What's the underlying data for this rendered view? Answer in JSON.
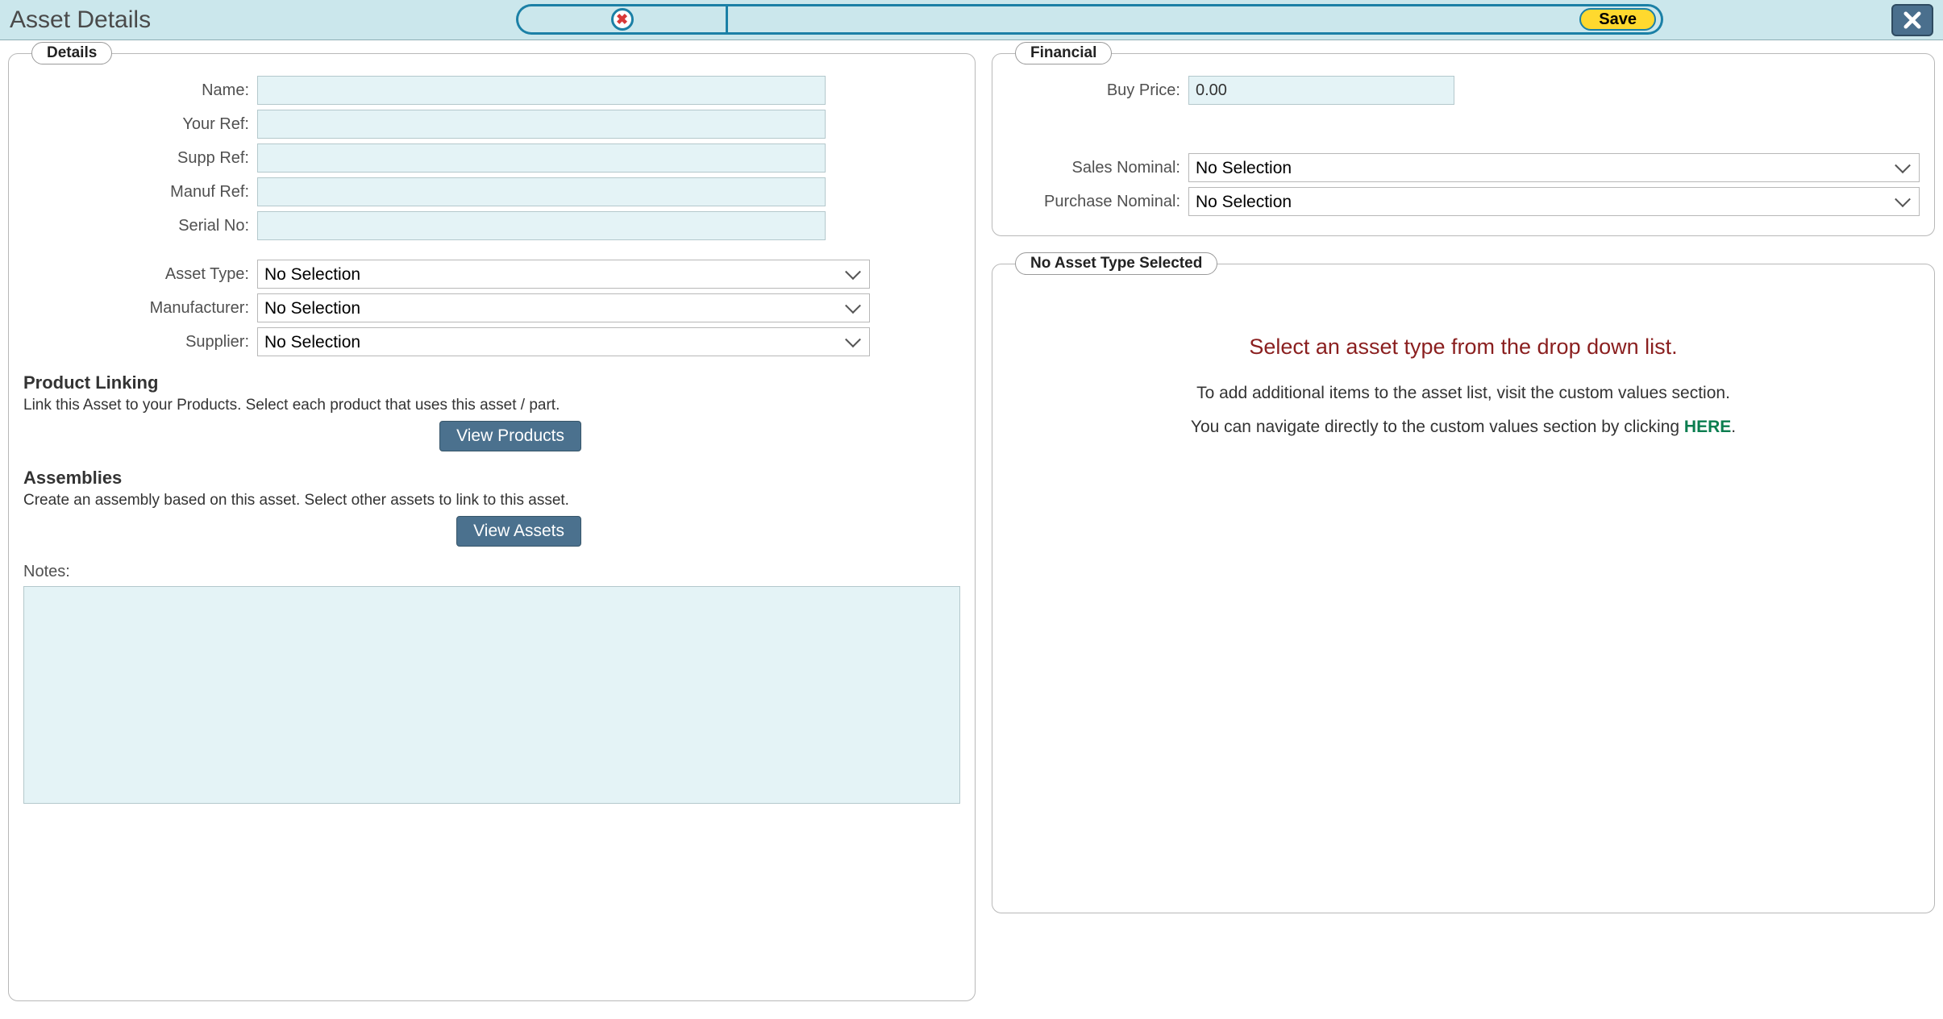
{
  "header": {
    "title": "Asset Details",
    "save_label": "Save"
  },
  "details": {
    "legend": "Details",
    "name_label": "Name:",
    "name_value": "",
    "your_ref_label": "Your Ref:",
    "your_ref_value": "",
    "supp_ref_label": "Supp Ref:",
    "supp_ref_value": "",
    "manuf_ref_label": "Manuf Ref:",
    "manuf_ref_value": "",
    "serial_no_label": "Serial No:",
    "serial_no_value": "",
    "asset_type_label": "Asset Type:",
    "asset_type_value": "No Selection",
    "manufacturer_label": "Manufacturer:",
    "manufacturer_value": "No Selection",
    "supplier_label": "Supplier:",
    "supplier_value": "No Selection",
    "product_linking_title": "Product Linking",
    "product_linking_text": "Link this Asset to your Products. Select each product that uses this asset / part.",
    "view_products_label": "View Products",
    "assemblies_title": "Assemblies",
    "assemblies_text": "Create an assembly based on this asset. Select other assets to link to this asset.",
    "view_assets_label": "View Assets",
    "notes_label": "Notes:",
    "notes_value": ""
  },
  "financial": {
    "legend": "Financial",
    "buy_price_label": "Buy Price:",
    "buy_price_value": "0.00",
    "sales_nominal_label": "Sales Nominal:",
    "sales_nominal_value": "No Selection",
    "purchase_nominal_label": "Purchase Nominal:",
    "purchase_nominal_value": "No Selection"
  },
  "asset_type_panel": {
    "legend": "No Asset Type Selected",
    "title": "Select an asset type from the drop down list.",
    "line1": "To add additional items to the asset list, visit the custom values section.",
    "line2_prefix": "You can navigate directly to the custom values section by clicking ",
    "here_label": "HERE",
    "line2_suffix": "."
  }
}
